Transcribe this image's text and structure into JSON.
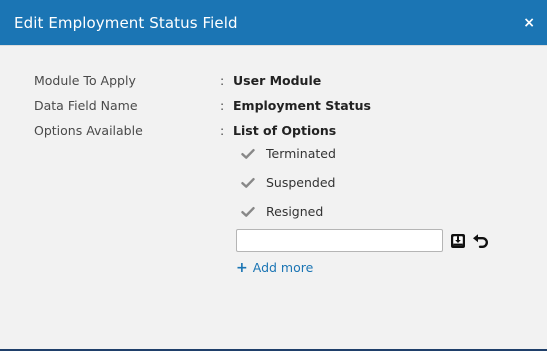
{
  "dialog": {
    "title": "Edit Employment Status Field",
    "close_label": "×"
  },
  "fields": [
    {
      "label": "Module To Apply",
      "separator": ":",
      "value": "User Module"
    },
    {
      "label": "Data Field Name",
      "separator": ":",
      "value": "Employment Status"
    },
    {
      "label": "Options Available",
      "separator": ":",
      "value": "List of Options"
    }
  ],
  "options": [
    {
      "label": "Terminated",
      "icon": "check-icon"
    },
    {
      "label": "Suspended",
      "icon": "check-icon"
    },
    {
      "label": "Resigned",
      "icon": "check-icon"
    }
  ],
  "new_option": {
    "value": "",
    "placeholder": "",
    "save_icon": "save-icon",
    "undo_icon": "undo-icon"
  },
  "add_more": {
    "icon": "plus-icon",
    "label": "Add more"
  },
  "colors": {
    "header": "#1b75b4",
    "body": "#f2f2f2",
    "link": "#1b75b4",
    "check": "#888888"
  }
}
